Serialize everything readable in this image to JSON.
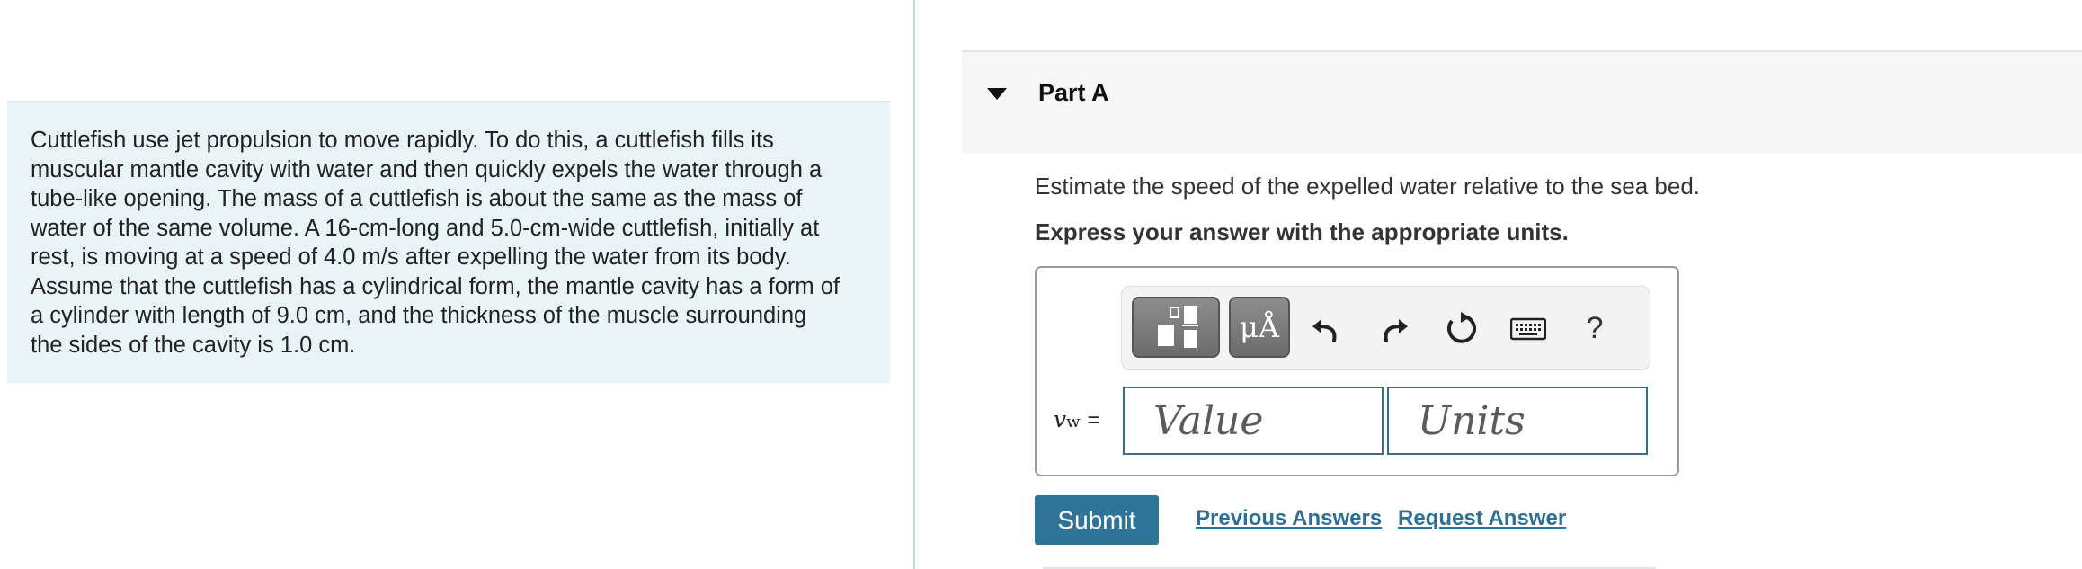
{
  "problem": {
    "text": "Cuttlefish use jet propulsion to move rapidly. To do this, a cuttlefish fills its\nmuscular mantle cavity with water and then quickly expels the water through a\ntube-like opening. The mass of a cuttlefish is about the same as the mass of\nwater of the same volume. A 16-cm-long and 5.0-cm-wide cuttlefish, initially at\nrest, is moving at a speed of 4.0 m/s after expelling the water from its body.\nAssume that the cuttlefish has a cylindrical form, the mantle cavity has a form of\na cylinder with length of 9.0 cm, and the thickness of the muscle surrounding\nthe sides of the cavity is 1.0 cm."
  },
  "part": {
    "title": "Part A",
    "question": "Estimate the speed of the expelled water relative to the sea bed.",
    "instruction": "Express your answer with the appropriate units."
  },
  "toolbar": {
    "units_label": "μÅ",
    "help_label": "?",
    "icons": [
      "templates-icon",
      "units-icon",
      "undo-icon",
      "redo-icon",
      "reset-icon",
      "keyboard-icon",
      "help-icon"
    ]
  },
  "answer": {
    "variable": "v",
    "variable_sub": "w",
    "equals": "=",
    "value_placeholder": "Value",
    "units_placeholder": "Units",
    "value": "",
    "units": ""
  },
  "actions": {
    "submit_label": "Submit",
    "previous_answers_label": "Previous Answers",
    "request_answer_label": "Request Answer"
  },
  "colors": {
    "accent": "#2f7396",
    "link": "#2f6f94",
    "problem_bg": "#e8f4f6",
    "field_border": "#2e6f8e"
  }
}
